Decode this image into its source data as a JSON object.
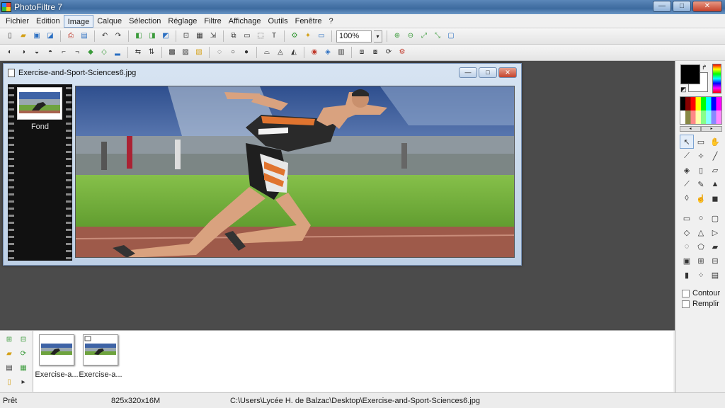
{
  "app": {
    "title": "PhotoFiltre 7"
  },
  "window_controls": {
    "minimize": "—",
    "maximize": "□",
    "close": "✕"
  },
  "menu": [
    "Fichier",
    "Edition",
    "Image",
    "Calque",
    "Sélection",
    "Réglage",
    "Filtre",
    "Affichage",
    "Outils",
    "Fenêtre",
    "?"
  ],
  "toolbar": {
    "zoom": "100%",
    "zoom_drop": "▾"
  },
  "document": {
    "title": "Exercise-and-Sport-Sciences6.jpg",
    "layer_label": "Fond",
    "controls": {
      "minimize": "—",
      "maximize": "□",
      "close": "✕"
    }
  },
  "palette": {
    "contour_label": "Contour",
    "remplir_label": "Remplir",
    "scroll_left": "◂",
    "scroll_right": "▸"
  },
  "thumbnails": [
    {
      "label": "Exercise-a..."
    },
    {
      "label": "Exercise-a..."
    }
  ],
  "status": {
    "state": "Prêt",
    "dimensions": "825x320x16M",
    "path": "C:\\Users\\Lycée H. de Balzac\\Desktop\\Exercise-and-Sport-Sciences6.jpg"
  },
  "colors": {
    "foreground": "#000000",
    "background": "#ffffff",
    "title_bar": "#3d6a9e",
    "workspace": "#4b4b4b"
  }
}
